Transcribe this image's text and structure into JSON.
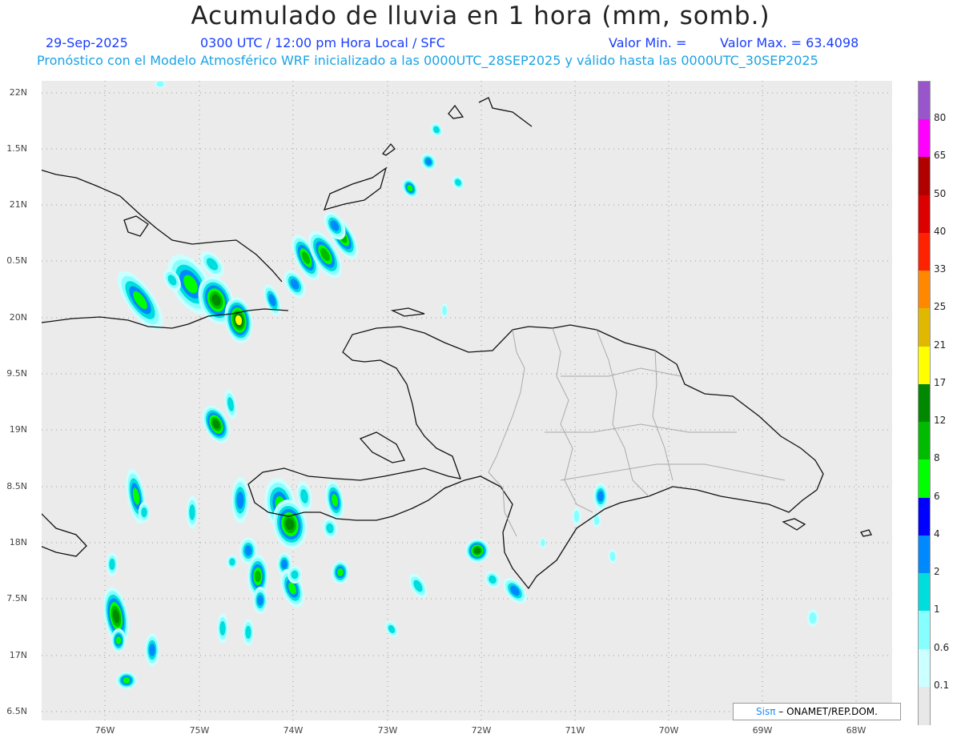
{
  "header": {
    "title": "Acumulado de lluvia en 1 hora (mm, somb.)",
    "date": "29-Sep-2025",
    "time_info": "0300 UTC / 12:00 pm Hora Local / SFC",
    "min_label": "Valor Min. =",
    "max_label": "Valor Max. = 63.4098",
    "model_info": "Pronóstico con el Modelo Atmosférico WRF inicializado a las 0000UTC_28SEP2025 y válido hasta las  0000UTC_30SEP2025"
  },
  "axes": {
    "lat_labels": [
      "22N",
      "1.5N",
      "21N",
      "0.5N",
      "20N",
      "9.5N",
      "19N",
      "8.5N",
      "18N",
      "7.5N",
      "17N",
      "6.5N"
    ],
    "lon_labels": [
      "76W",
      "75W",
      "74W",
      "73W",
      "72W",
      "71W",
      "70W",
      "69W",
      "68W"
    ]
  },
  "colorbar": {
    "labels": [
      "80",
      "65",
      "50",
      "40",
      "33",
      "25",
      "21",
      "17",
      "12",
      "8",
      "6",
      "4",
      "2",
      "1",
      "0.6",
      "0.1"
    ],
    "colors": [
      "#9955cc",
      "#ff00ff",
      "#b00000",
      "#dd0000",
      "#ff2200",
      "#ff8800",
      "#e0b800",
      "#ffff00",
      "#008800",
      "#00bb00",
      "#00ff00",
      "#0000ff",
      "#0088ff",
      "#00dddd",
      "#88ffff",
      "#ccffff",
      "#e8e8e8"
    ]
  },
  "credit": {
    "logo_text": "Sisπ",
    "org_text": "– ONAMET/REP.DOM."
  }
}
